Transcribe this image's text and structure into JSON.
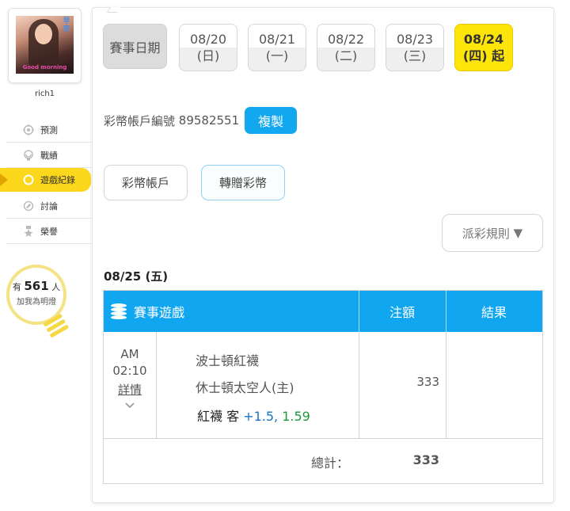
{
  "sidebar": {
    "avatar": {
      "badge": "早安",
      "caption": "Good morning"
    },
    "username": "rich1",
    "menu": [
      {
        "label": "預測",
        "icon": "target-icon",
        "active": false
      },
      {
        "label": "戰績",
        "icon": "trophy-icon",
        "active": false
      },
      {
        "label": "遊戲紀錄",
        "icon": "record-icon",
        "active": true
      },
      {
        "label": "討論",
        "icon": "discuss-icon",
        "active": false
      },
      {
        "label": "榮譽",
        "icon": "medal-icon",
        "active": false
      }
    ],
    "bulb": {
      "prefix": "有",
      "count": "561",
      "suffix": "人",
      "caption": "加我為明燈"
    }
  },
  "dates": {
    "label": "賽事日期",
    "items": [
      {
        "date": "08/20",
        "day": "(日)",
        "active": false
      },
      {
        "date": "08/21",
        "day": "(一)",
        "active": false
      },
      {
        "date": "08/22",
        "day": "(二)",
        "active": false
      },
      {
        "date": "08/23",
        "day": "(三)",
        "active": false
      },
      {
        "date": "08/24",
        "day": "(四) 起",
        "active": true
      }
    ]
  },
  "account": {
    "label": "彩幣帳戶編號",
    "number": "89582551",
    "copy_label": "複製"
  },
  "tabs": [
    {
      "label": "彩幣帳戶",
      "active": false
    },
    {
      "label": "轉贈彩幣",
      "active": true
    }
  ],
  "rules": {
    "label": "派彩規則",
    "arrow": "▼"
  },
  "day_title": "08/25 (五)",
  "table": {
    "headers": {
      "game": "賽事遊戲",
      "stake": "注額",
      "result": "結果"
    },
    "rows": [
      {
        "ampm": "AM",
        "time": "02:10",
        "detail_label": "詳情",
        "away_team": "波士頓紅襪",
        "home_team": "休士頓太空人(主)",
        "pick_team": "紅襪 客",
        "pick_handicap": "+1.5,",
        "pick_odds": "1.59",
        "stake": "333",
        "result": ""
      }
    ],
    "total_label": "總計：",
    "total_value": "333"
  }
}
